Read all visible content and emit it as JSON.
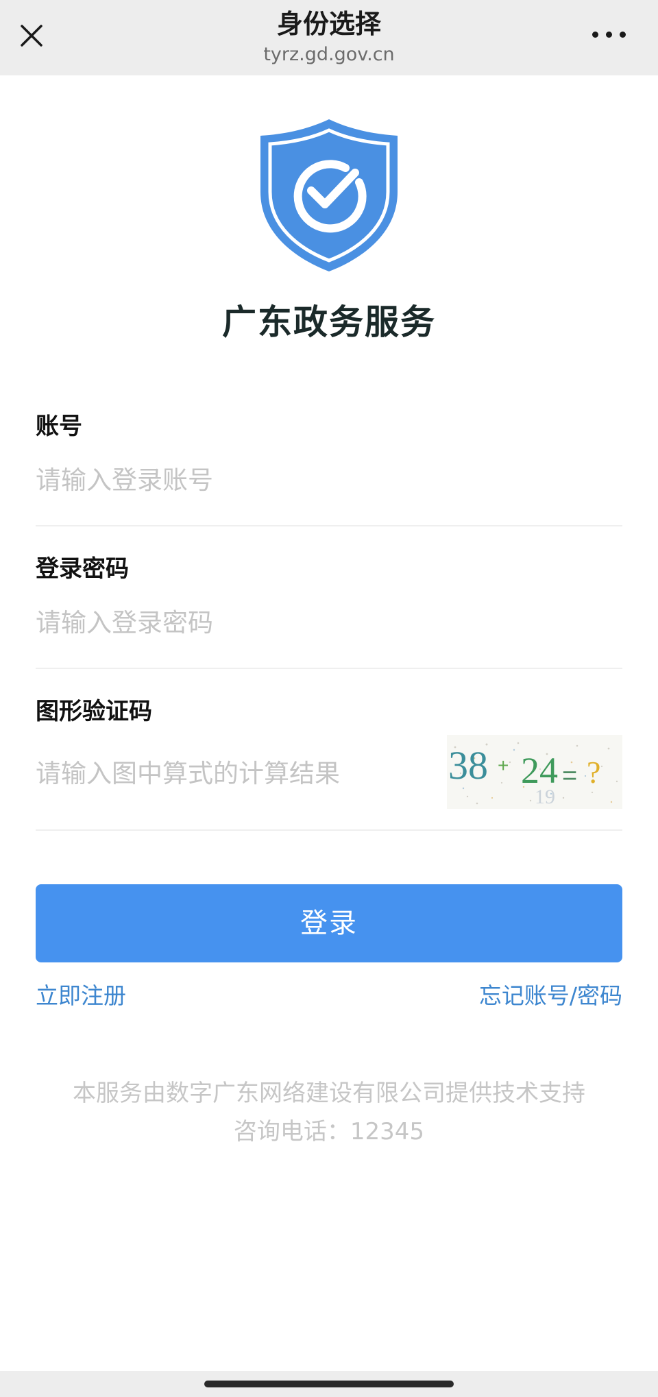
{
  "header": {
    "title": "身份选择",
    "url": "tyrz.gd.gov.cn",
    "close_icon": "close-icon",
    "more_icon": "more-icon"
  },
  "brand": {
    "name": "广东政务服务",
    "logo_icon": "shield-check-icon",
    "logo_color": "#4a90e2"
  },
  "form": {
    "account": {
      "label": "账号",
      "placeholder": "请输入登录账号",
      "value": ""
    },
    "password": {
      "label": "登录密码",
      "placeholder": "请输入登录密码",
      "value": ""
    },
    "captcha": {
      "label": "图形验证码",
      "placeholder": "请输入图中算式的计算结果",
      "value": "",
      "image_text": "38+24=?"
    },
    "submit_label": "登录"
  },
  "links": {
    "register": "立即注册",
    "forgot": "忘记账号/密码"
  },
  "footer": {
    "line1": "本服务由数字广东网络建设有限公司提供技术支持",
    "line2": "咨询电话：12345"
  },
  "colors": {
    "primary": "#4692ef",
    "link": "#3d86cf",
    "placeholder": "#c4c4c4"
  }
}
